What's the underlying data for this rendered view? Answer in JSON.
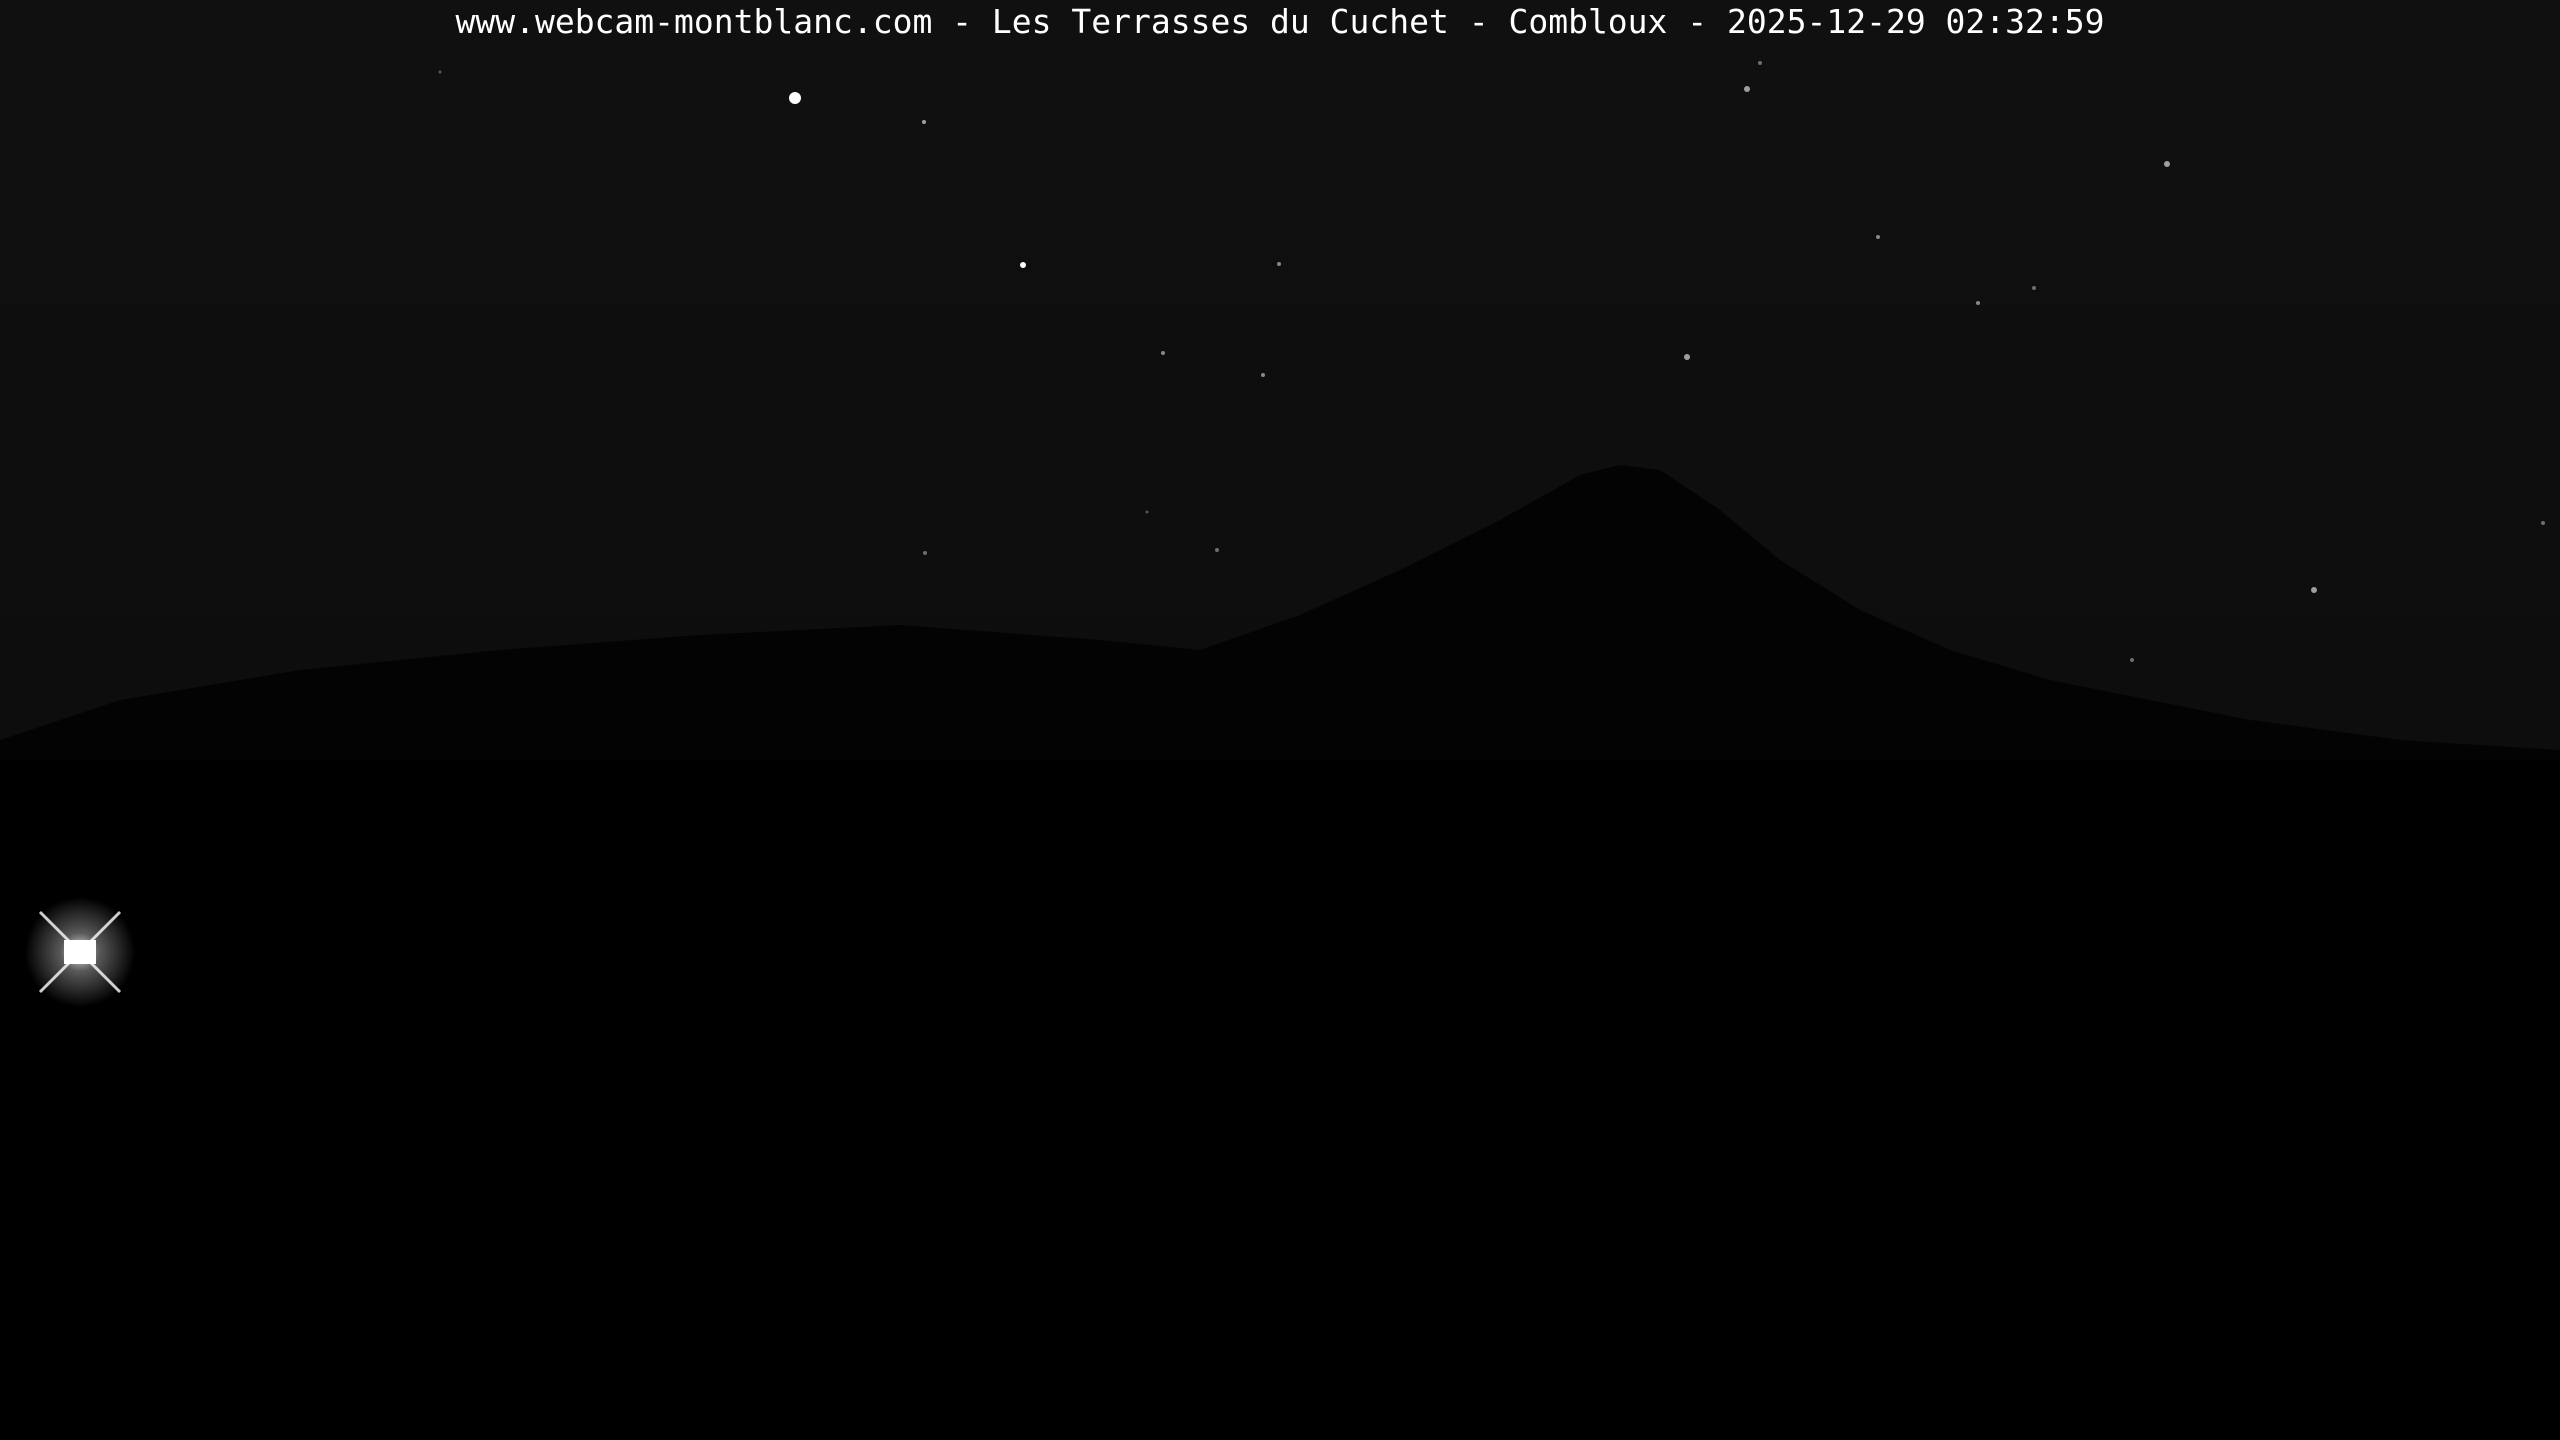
{
  "caption": {
    "text": "www.webcam-montblanc.com - Les Terrasses du Cuchet - Combloux - 2025-12-29 02:32:59"
  },
  "scene": {
    "kind": "night webcam view",
    "sky_color": "#0d0d0d",
    "mountain_color": "#020202",
    "foreground_color": "#000000",
    "light_color": "#ffffff"
  }
}
